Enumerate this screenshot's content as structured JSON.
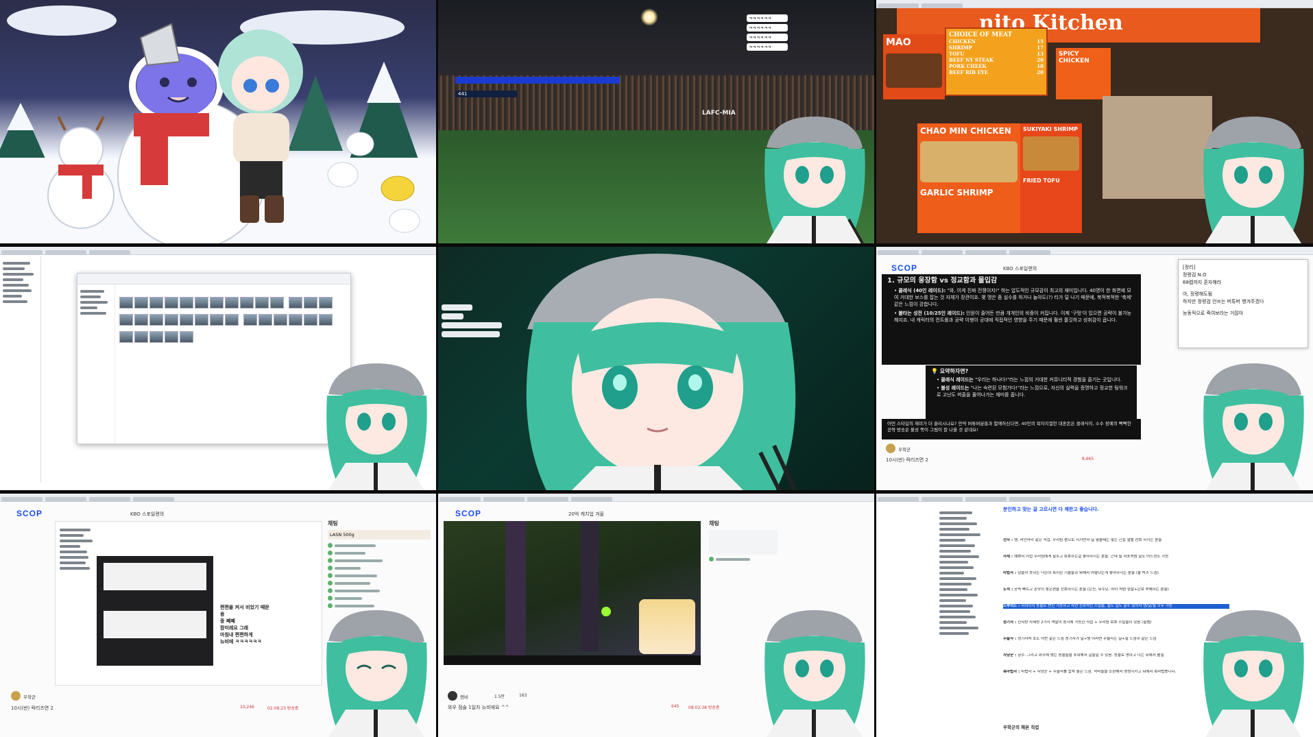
{
  "tiles": {
    "t2": {
      "scoreboard": "LAFC-MIA",
      "score_home": "441",
      "chat": [
        "ㅋㅋㅋㅋㅋㅋ",
        "ㅋㅋㅋㅋㅋㅋ",
        "ㅋㅋㅋㅋㅋㅋ",
        "ㅋㅋㅋㅋㅋㅋ"
      ]
    },
    "t3": {
      "sign_title": "nito Kitchen",
      "menu_heading": "CHOICE OF MEAT",
      "menu_items": [
        {
          "name": "CHICKEN",
          "price": "15"
        },
        {
          "name": "SHRIMP",
          "price": "17"
        },
        {
          "name": "TOFU",
          "price": "13"
        },
        {
          "name": "BEEF NY STEAK",
          "price": "20"
        },
        {
          "name": "PORK CHEEK",
          "price": "18"
        },
        {
          "name": "BEEF RIB EYE",
          "price": "20"
        }
      ],
      "card_mao": "MAO",
      "card_chaomin": "CHAO MIN CHICKEN",
      "card_garlic": "GARLIC SHRIMP",
      "card_spicy": "SPICY CHICKEN",
      "card_sukiyaki": "SUKIYAKI SHRIMP",
      "card_fried_tofu": "FRIED TOFU"
    },
    "t6": {
      "logo": "SCOP",
      "channel": "KBO 스포일렌의",
      "heading": "1. 규모의 웅장함 vs 정교함과 몰입감",
      "bullets": [
        {
          "label": "클레식 (40인 레이드):",
          "text": "\"와, 이게 진짜 전쟁이지!\" 하는 압도적인 규모감이 최고의 재미입니다. 40명이 한 화면에 모여 거대한 보스를 잡는 것 자체가 장관이죠. 몇 명은 좀 실수를 하거나 놀아도(?) 티가 덜 나기 때문에, 북적북적한 '축제' 같은 느낌이 강합니다."
        },
        {
          "label": "불타는 성전 (10/25인 레이드):",
          "text": "인원이 줄어든 만큼 개개인의 비중이 커집니다. 이제 '구멍'이 있으면 공략이 불가능해지죠. 내 캐릭터의 컨트롤과 공략 이행이 공대에 직접적인 영향을 주기 때문에 훨씬 쫄깃하고 성취감이 큽니다."
        }
      ],
      "summary_title": "요약하자면?",
      "summary_items": [
        {
          "label": "클래식 레이드는",
          "text": "\"우리는 하나다!\"라는 느낌의 거대한 커뮤니티적 경험을 즐기는 곳입니다."
        },
        {
          "label": "불성 레이드는",
          "text": "\"나는 숙련된 모험가다!\"라는 느낌으로, 자신의 실력을 증명하고 정교한 팀워크로 고난도 퍼즐을 풀어나가는 재미를 줍니다."
        }
      ],
      "closing": "어떤 스타일의 재미가 더 끌리시나요? 만약 버튜버분들과 함께하신다면, 40인의 왁자지껄한 대혼돈은 클래식이, 소수 정예의 빡빡한 공략 방송은 불성 쪽이 그림이 잘 나올 것 같네요!",
      "notepad": [
        "[정리]",
        "정령검 N.O",
        "68렙까지 혼자해라",
        "아, 정령해도됨",
        "하지만 정령검 안쓰는 버튜버 챙겨주겠다",
        "능동적으로 죽여보라는 거잖아"
      ],
      "streamer": "우학군",
      "stream_title": "10시(반) 락리즈면 2",
      "viewers": "8,665"
    },
    "t7": {
      "logo": "SCOP",
      "channel": "KBO 스포일렌의",
      "chat_title": "채팅",
      "donation": "LASN 500g",
      "overlay_text": [
        "쩐쩐을 켜서 비었기 때문 용",
        "종 쩨쩨",
        "팜미레요 그래",
        "마침내 쩐쩐하게",
        "뉴비에 ㅋㅋㅋㅋㅋㅋ"
      ],
      "streamer": "우학군",
      "stream_title": "10시(반) 락리즈면 2",
      "viewers": "10,246",
      "time": "02:08:23 방송중"
    },
    "t8": {
      "logo": "SCOP",
      "channel": "20억 캐치업 겨울",
      "chat_title": "채팅",
      "streamer": "엔비",
      "stream_title": "와우 점술 1일차 뉴비에요 ^^",
      "viewers": "645",
      "time": "08:02:38 방송중",
      "likes": "1.5만",
      "follow": "163"
    },
    "t9": {
      "banner": "분인하고 맞는 걸 고르시면 다 제한고 좋습니다.",
      "lines": [
        {
          "label": "전사",
          "text": "탱, 라인마리 같은 직업. 우리팀 몸으로 지키면서 딜 넣을때는 넣는 근접 멀빨 선호 하시는 분들"
        },
        {
          "label": "사제",
          "text": "예쁘서 이업 우리팀에게 힐주고 보호하는걸 좋아하시는 분들. 근데 힐 서포처럼 딜도 어느정도 가능"
        },
        {
          "label": "마법사",
          "text": "남들이 못하는 너한의 특이한 기술들과 뭐해서 어떻냐는게 좋아하시는 분들 (불 빅스 느낌)"
        },
        {
          "label": "도적",
          "text": "공속 빠르고 손맛이 좋은편을 선호하시는 분들 (은신, 뒤수오, 마이 처럼 암살+은보 부폐하는 분들)"
        },
        {
          "label": "드루이드",
          "text": "하려하지 동물로 변신 가능하고 자연 친화적인 스킬들, 힐도 딥도 할수 있어서 탱/딜/힐 모두 가능"
        },
        {
          "label": "성기사",
          "text": "진사랑 사제랑 2가지 역할이 동시에 가능한 직업 + 우리팀 보호 스킬들이 있음 (힐템)"
        },
        {
          "label": "주술사",
          "text": "성기사처 포도 어찬 같은 느낌 성기사가 딜+탱 이라면 주술사는 딜+힐 느낌이 같은 느낌"
        },
        {
          "label": "사냥꾼",
          "text": "궁수. 그리고 화우에 펫는 동물들을 포획해서 길들일 수 있음. 동물로 명하고 나는 뒤에서 활질"
        },
        {
          "label": "흑마법사",
          "text": "마법사 + 사냥꾼 + 주술사를 합쳐 놓은 느낌. 악마들을 소환해서 명령시키고 뒤에서 흑마법씀니다."
        }
      ],
      "footer": "우학군의 해본 직업"
    }
  },
  "colors": {
    "scoop_blue": "#1b4ef0",
    "character_hair": "#3fbf9f",
    "menu_board": "#e5521f",
    "highlight": "#1f5fd1"
  }
}
